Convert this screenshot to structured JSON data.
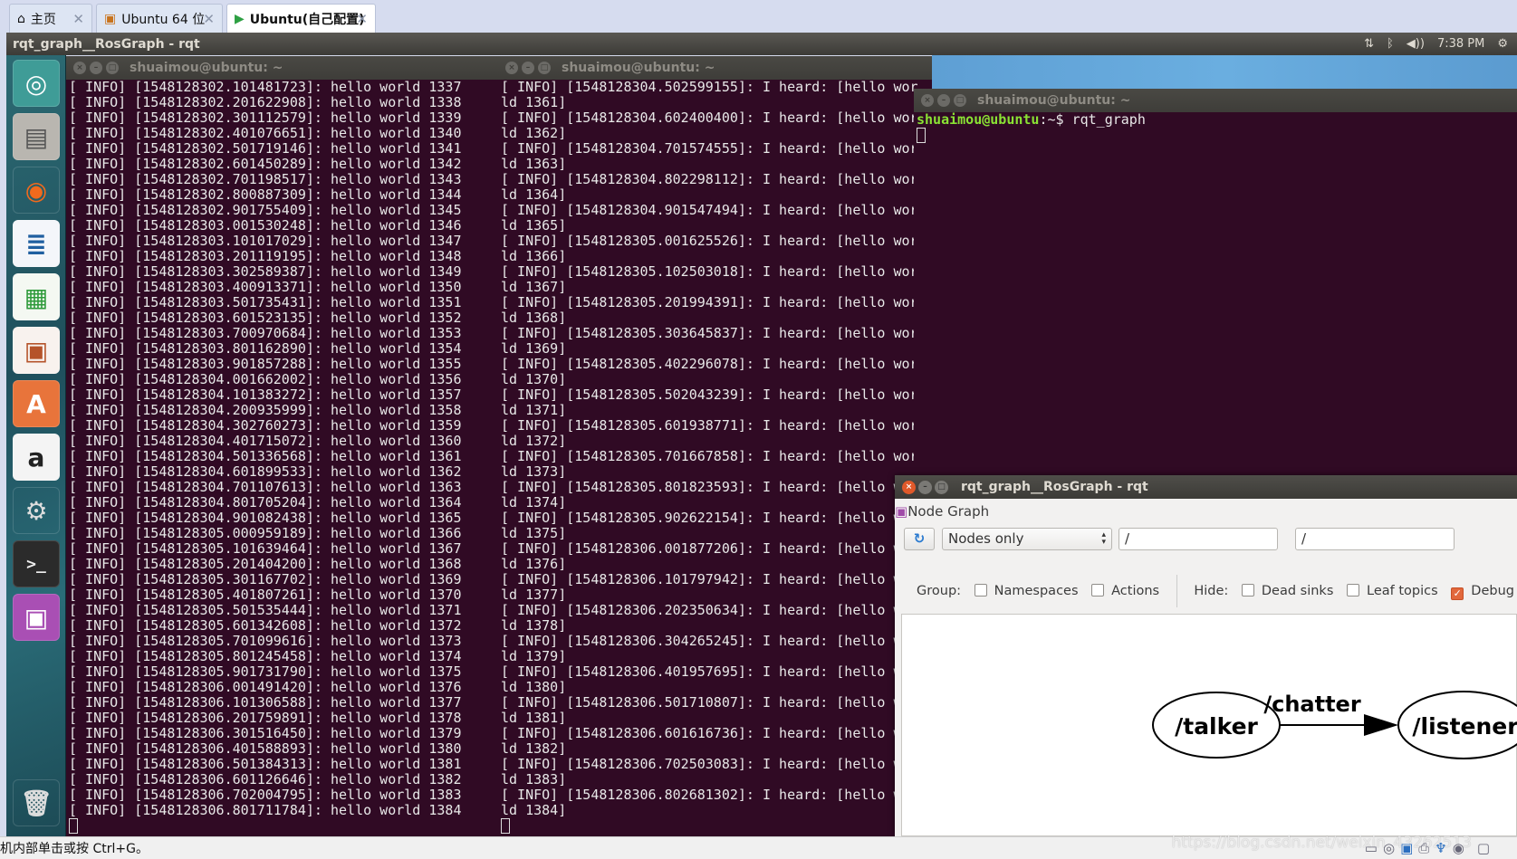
{
  "browser_tabs": [
    {
      "label": "主页",
      "icon": "home-icon"
    },
    {
      "label": "Ubuntu 64 位",
      "icon": "vm-icon"
    },
    {
      "label": "Ubuntu(自己配置)",
      "icon": "vm-running-icon",
      "active": true
    }
  ],
  "topbar": {
    "title": "rqt_graph__RosGraph - rqt",
    "clock": "7:38 PM",
    "indicators": [
      "network-updown-icon",
      "bluetooth-icon",
      "volume-icon",
      "power-gear-icon"
    ]
  },
  "launcher": [
    "ubuntu-dash-icon",
    "files-icon",
    "firefox-icon",
    "writer-icon",
    "calc-icon",
    "impress-icon",
    "software-center-icon",
    "amazon-icon",
    "system-settings-icon",
    "terminal-icon",
    "rqt-graph-icon",
    "trash-icon"
  ],
  "terminal1": {
    "title": "shuaimou@ubuntu: ~",
    "lines": [
      [
        "1548128302.101481723",
        "1337"
      ],
      [
        "1548128302.201622908",
        "1338"
      ],
      [
        "1548128302.301112579",
        "1339"
      ],
      [
        "1548128302.401076651",
        "1340"
      ],
      [
        "1548128302.501719146",
        "1341"
      ],
      [
        "1548128302.601450289",
        "1342"
      ],
      [
        "1548128302.701198517",
        "1343"
      ],
      [
        "1548128302.800887309",
        "1344"
      ],
      [
        "1548128302.901755409",
        "1345"
      ],
      [
        "1548128303.001530248",
        "1346"
      ],
      [
        "1548128303.101017029",
        "1347"
      ],
      [
        "1548128303.201119195",
        "1348"
      ],
      [
        "1548128303.302589387",
        "1349"
      ],
      [
        "1548128303.400913371",
        "1350"
      ],
      [
        "1548128303.501735431",
        "1351"
      ],
      [
        "1548128303.601523135",
        "1352"
      ],
      [
        "1548128303.700970684",
        "1353"
      ],
      [
        "1548128303.801162890",
        "1354"
      ],
      [
        "1548128303.901857288",
        "1355"
      ],
      [
        "1548128304.001662002",
        "1356"
      ],
      [
        "1548128304.101383272",
        "1357"
      ],
      [
        "1548128304.200935999",
        "1358"
      ],
      [
        "1548128304.302760273",
        "1359"
      ],
      [
        "1548128304.401715072",
        "1360"
      ],
      [
        "1548128304.501336568",
        "1361"
      ],
      [
        "1548128304.601899533",
        "1362"
      ],
      [
        "1548128304.701107613",
        "1363"
      ],
      [
        "1548128304.801705204",
        "1364"
      ],
      [
        "1548128304.901082438",
        "1365"
      ],
      [
        "1548128305.000959189",
        "1366"
      ],
      [
        "1548128305.101639464",
        "1367"
      ],
      [
        "1548128305.201404200",
        "1368"
      ],
      [
        "1548128305.301167702",
        "1369"
      ],
      [
        "1548128305.401807261",
        "1370"
      ],
      [
        "1548128305.501535444",
        "1371"
      ],
      [
        "1548128305.601342608",
        "1372"
      ],
      [
        "1548128305.701099616",
        "1373"
      ],
      [
        "1548128305.801245458",
        "1374"
      ],
      [
        "1548128305.901731790",
        "1375"
      ],
      [
        "1548128306.001491420",
        "1376"
      ],
      [
        "1548128306.101306588",
        "1377"
      ],
      [
        "1548128306.201759891",
        "1378"
      ],
      [
        "1548128306.301516450",
        "1379"
      ],
      [
        "1548128306.401588893",
        "1380"
      ],
      [
        "1548128306.501384313",
        "1381"
      ],
      [
        "1548128306.601126646",
        "1382"
      ],
      [
        "1548128306.702004795",
        "1383"
      ],
      [
        "1548128306.801711784",
        "1384"
      ]
    ],
    "prefix": "[ INFO] ",
    "message": "hello world "
  },
  "terminal2": {
    "title": "shuaimou@ubuntu: ~",
    "lines": [
      [
        "1548128304.502599155",
        "1361"
      ],
      [
        "1548128304.602400400",
        "1362"
      ],
      [
        "1548128304.701574555",
        "1363"
      ],
      [
        "1548128304.802298112",
        "1364"
      ],
      [
        "1548128304.901547494",
        "1365"
      ],
      [
        "1548128305.001625526",
        "1366"
      ],
      [
        "1548128305.102503018",
        "1367"
      ],
      [
        "1548128305.201994391",
        "1368"
      ],
      [
        "1548128305.303645837",
        "1369"
      ],
      [
        "1548128305.402296078",
        "1370"
      ],
      [
        "1548128305.502043239",
        "1371"
      ],
      [
        "1548128305.601938771",
        "1372"
      ],
      [
        "1548128305.701667858",
        "1373"
      ],
      [
        "1548128305.801823593",
        "1374"
      ],
      [
        "1548128305.902622154",
        "1375"
      ],
      [
        "1548128306.001877206",
        "1376"
      ],
      [
        "1548128306.101797942",
        "1377"
      ],
      [
        "1548128306.202350634",
        "1378"
      ],
      [
        "1548128306.304265245",
        "1379"
      ],
      [
        "1548128306.401957695",
        "1380"
      ],
      [
        "1548128306.501710807",
        "1381"
      ],
      [
        "1548128306.601616736",
        "1382"
      ],
      [
        "1548128306.702503083",
        "1383"
      ],
      [
        "1548128306.802681302",
        "1384"
      ]
    ],
    "prefix": "[ INFO] ",
    "message": "I heard: [hello world "
  },
  "terminal3": {
    "title": "shuaimou@ubuntu: ~",
    "prompt_user": "shuaimou@ubuntu",
    "prompt_path": ":~$ ",
    "command": "rqt_graph"
  },
  "rqt": {
    "title": "rqt_graph__RosGraph - rqt",
    "plugin_title": "Node Graph",
    "mode_select": "Nodes only",
    "ns_filter": "/",
    "topic_filter": "/",
    "group_label": "Group:",
    "hide_label": "Hide:",
    "checkboxes": [
      {
        "label": "Namespaces",
        "checked": false
      },
      {
        "label": "Actions",
        "checked": false
      },
      {
        "label": "Dead sinks",
        "checked": false
      },
      {
        "label": "Leaf topics",
        "checked": false
      },
      {
        "label": "Debug",
        "checked": true
      }
    ],
    "graph": {
      "nodes": [
        "/talker",
        "/listener"
      ],
      "edge": "/chatter"
    }
  },
  "statusbar": {
    "hint": "机内部单击或按 Ctrl+G。",
    "watermark": "https://blog.csdn.net/weixin_43262513",
    "icons": [
      "hdd-icon",
      "cdrom-icon",
      "network-icon",
      "printer-icon",
      "usb-icon",
      "webcam-icon",
      "notes-icon"
    ]
  },
  "colors": {
    "terminal_bg": "#300a24",
    "prompt_green": "#8ae234",
    "checkbox_accent": "#e2683c"
  }
}
